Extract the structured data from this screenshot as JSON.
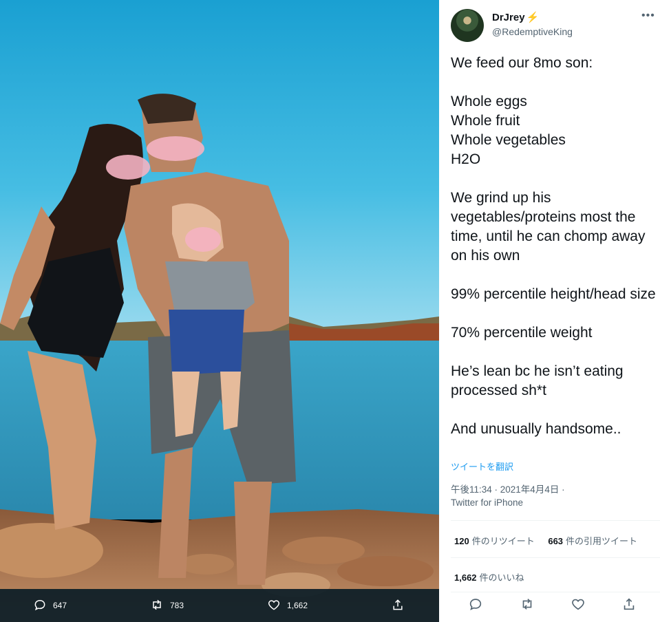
{
  "photo_actions": {
    "replies": "647",
    "retweets": "783",
    "likes": "1,662"
  },
  "tweet": {
    "display_name": "DrJrey",
    "badge": "⚡",
    "handle": "@RedemptiveKing",
    "more_label": "•••",
    "text": "We feed our 8mo son:\n\nWhole eggs\nWhole fruit\nWhole vegetables\nH2O\n\nWe grind up his vegetables/proteins most the time, until he can chomp away on his own\n\n99% percentile height/head size\n\n70% percentile weight\n\nHe’s lean bc he isn’t eating processed sh*t\n\nAnd unusually handsome..",
    "translate": "ツイートを翻訳",
    "timestamp": "午後11:34 · 2021年4月4日 ·",
    "source": "Twitter for iPhone"
  },
  "stats": {
    "retweets_count": "120",
    "retweets_label": "件のリツイート",
    "quotes_count": "663",
    "quotes_label": "件の引用ツイート",
    "likes_count": "1,662",
    "likes_label": "件のいいね"
  },
  "icons": {
    "reply": "reply-icon",
    "retweet": "retweet-icon",
    "like": "heart-icon",
    "share": "share-icon"
  },
  "colors": {
    "link": "#1d9bf0",
    "text": "#0f1419",
    "secondary": "#536471",
    "badge": "#f4b400",
    "photo_bar": "#0a1c26"
  }
}
